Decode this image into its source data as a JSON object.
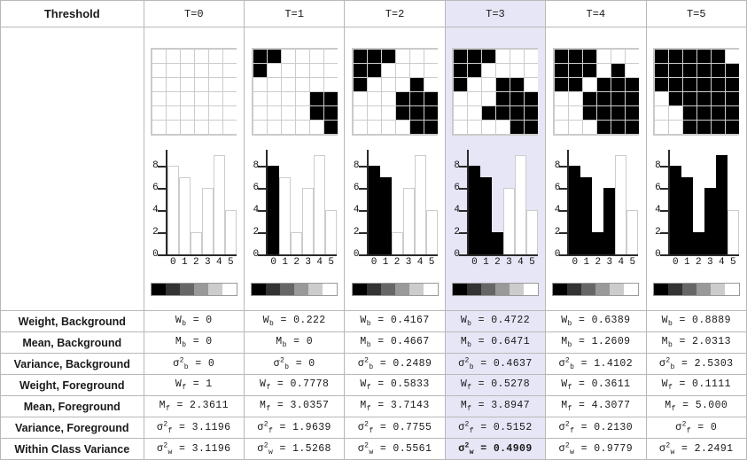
{
  "header": {
    "label": "Threshold",
    "columns": [
      "T=0",
      "T=1",
      "T=2",
      "T=3",
      "T=4",
      "T=5"
    ],
    "highlight_index": 3,
    "highlight_color": "#e6e6f7"
  },
  "chart_data": {
    "type": "bar",
    "title": "Otsu's method threshold histograms",
    "categories": [
      "0",
      "1",
      "2",
      "3",
      "4",
      "5"
    ],
    "values": [
      8,
      7,
      2,
      6,
      9,
      4
    ],
    "xlabel": "",
    "ylabel": "",
    "ylim": [
      0,
      9
    ],
    "ytick_labels": [
      "0",
      "2",
      "4",
      "6",
      "8"
    ],
    "ytick_values": [
      0,
      2,
      4,
      6,
      8
    ],
    "grid": false,
    "legend": "none",
    "note": "Same histogram repeated per column; bars with gray level < T are filled black (background class), the rest are white (foreground class).",
    "panels": [
      {
        "threshold": "T=0",
        "black_bars": 0
      },
      {
        "threshold": "T=1",
        "black_bars": 1
      },
      {
        "threshold": "T=2",
        "black_bars": 2
      },
      {
        "threshold": "T=3",
        "black_bars": 3
      },
      {
        "threshold": "T=4",
        "black_bars": 4
      },
      {
        "threshold": "T=5",
        "black_bars": 5
      }
    ]
  },
  "grayscale_ramp": [
    "#000000",
    "#333333",
    "#666666",
    "#999999",
    "#cccccc",
    "#ffffff"
  ],
  "images": [
    {
      "threshold": "T=0",
      "pixels": [
        [
          0,
          0,
          0,
          0,
          0,
          0
        ],
        [
          0,
          0,
          0,
          0,
          0,
          0
        ],
        [
          0,
          0,
          0,
          0,
          0,
          0
        ],
        [
          0,
          0,
          0,
          0,
          0,
          0
        ],
        [
          0,
          0,
          0,
          0,
          0,
          0
        ],
        [
          0,
          0,
          0,
          0,
          0,
          0
        ]
      ]
    },
    {
      "threshold": "T=1",
      "pixels": [
        [
          1,
          1,
          0,
          0,
          0,
          0
        ],
        [
          1,
          0,
          0,
          0,
          0,
          0
        ],
        [
          0,
          0,
          0,
          0,
          0,
          0
        ],
        [
          0,
          0,
          0,
          0,
          1,
          1
        ],
        [
          0,
          0,
          0,
          0,
          1,
          1
        ],
        [
          0,
          0,
          0,
          0,
          0,
          1
        ]
      ]
    },
    {
      "threshold": "T=2",
      "pixels": [
        [
          1,
          1,
          1,
          0,
          0,
          0
        ],
        [
          1,
          1,
          0,
          0,
          0,
          0
        ],
        [
          1,
          0,
          0,
          0,
          1,
          0
        ],
        [
          0,
          0,
          0,
          1,
          1,
          1
        ],
        [
          0,
          0,
          0,
          1,
          1,
          1
        ],
        [
          0,
          0,
          0,
          0,
          1,
          1
        ]
      ]
    },
    {
      "threshold": "T=3",
      "pixels": [
        [
          1,
          1,
          1,
          0,
          0,
          0
        ],
        [
          1,
          1,
          0,
          0,
          0,
          0
        ],
        [
          1,
          0,
          0,
          1,
          1,
          0
        ],
        [
          0,
          0,
          0,
          1,
          1,
          1
        ],
        [
          0,
          0,
          1,
          1,
          1,
          1
        ],
        [
          0,
          0,
          0,
          0,
          1,
          1
        ]
      ]
    },
    {
      "threshold": "T=4",
      "pixels": [
        [
          1,
          1,
          1,
          0,
          0,
          0
        ],
        [
          1,
          1,
          1,
          0,
          1,
          0
        ],
        [
          1,
          1,
          0,
          1,
          1,
          1
        ],
        [
          0,
          0,
          1,
          1,
          1,
          1
        ],
        [
          0,
          0,
          1,
          1,
          1,
          1
        ],
        [
          0,
          0,
          0,
          1,
          1,
          1
        ]
      ]
    },
    {
      "threshold": "T=5",
      "pixels": [
        [
          1,
          1,
          1,
          1,
          1,
          0
        ],
        [
          1,
          1,
          1,
          1,
          1,
          1
        ],
        [
          1,
          1,
          1,
          1,
          1,
          1
        ],
        [
          0,
          1,
          1,
          1,
          1,
          1
        ],
        [
          0,
          0,
          1,
          1,
          1,
          1
        ],
        [
          0,
          0,
          1,
          1,
          1,
          1
        ]
      ]
    }
  ],
  "rows": [
    {
      "label": "Weight, Background",
      "symbol": "W",
      "sub": "b",
      "sup": "",
      "values": [
        "0",
        "0.222",
        "0.4167",
        "0.4722",
        "0.6389",
        "0.8889"
      ]
    },
    {
      "label": "Mean, Background",
      "symbol": "M",
      "sub": "b",
      "sup": "",
      "values": [
        "0",
        "0",
        "0.4667",
        "0.6471",
        "1.2609",
        "2.0313"
      ]
    },
    {
      "label": "Variance, Background",
      "symbol": "σ",
      "sub": "b",
      "sup": "2",
      "values": [
        "0",
        "0",
        "0.2489",
        "0.4637",
        "1.4102",
        "2.5303"
      ]
    },
    {
      "label": "Weight, Foreground",
      "symbol": "W",
      "sub": "f",
      "sup": "",
      "values": [
        "1",
        "0.7778",
        "0.5833",
        "0.5278",
        "0.3611",
        "0.1111"
      ]
    },
    {
      "label": "Mean, Foreground",
      "symbol": "M",
      "sub": "f",
      "sup": "",
      "values": [
        "2.3611",
        "3.0357",
        "3.7143",
        "3.8947",
        "4.3077",
        "5.000"
      ]
    },
    {
      "label": "Variance, Foreground",
      "symbol": "σ",
      "sub": "f",
      "sup": "2",
      "values": [
        "3.1196",
        "1.9639",
        "0.7755",
        "0.5152",
        "0.2130",
        "0"
      ]
    },
    {
      "label": "Within Class Variance",
      "symbol": "σ",
      "sub": "w",
      "sup": "2",
      "values": [
        "3.1196",
        "1.5268",
        "0.5561",
        "0.4909",
        "0.9779",
        "2.2491"
      ],
      "bold_index": 3
    }
  ]
}
